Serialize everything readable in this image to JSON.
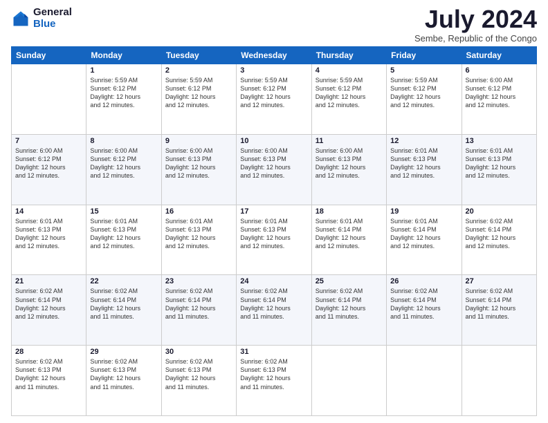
{
  "logo": {
    "general": "General",
    "blue": "Blue"
  },
  "header": {
    "month": "July 2024",
    "location": "Sembe, Republic of the Congo"
  },
  "weekdays": [
    "Sunday",
    "Monday",
    "Tuesday",
    "Wednesday",
    "Thursday",
    "Friday",
    "Saturday"
  ],
  "weeks": [
    [
      {
        "day": "",
        "info": ""
      },
      {
        "day": "1",
        "info": "Sunrise: 5:59 AM\nSunset: 6:12 PM\nDaylight: 12 hours\nand 12 minutes."
      },
      {
        "day": "2",
        "info": "Sunrise: 5:59 AM\nSunset: 6:12 PM\nDaylight: 12 hours\nand 12 minutes."
      },
      {
        "day": "3",
        "info": "Sunrise: 5:59 AM\nSunset: 6:12 PM\nDaylight: 12 hours\nand 12 minutes."
      },
      {
        "day": "4",
        "info": "Sunrise: 5:59 AM\nSunset: 6:12 PM\nDaylight: 12 hours\nand 12 minutes."
      },
      {
        "day": "5",
        "info": "Sunrise: 5:59 AM\nSunset: 6:12 PM\nDaylight: 12 hours\nand 12 minutes."
      },
      {
        "day": "6",
        "info": "Sunrise: 6:00 AM\nSunset: 6:12 PM\nDaylight: 12 hours\nand 12 minutes."
      }
    ],
    [
      {
        "day": "7",
        "info": ""
      },
      {
        "day": "8",
        "info": "Sunrise: 6:00 AM\nSunset: 6:12 PM\nDaylight: 12 hours\nand 12 minutes."
      },
      {
        "day": "9",
        "info": "Sunrise: 6:00 AM\nSunset: 6:13 PM\nDaylight: 12 hours\nand 12 minutes."
      },
      {
        "day": "10",
        "info": "Sunrise: 6:00 AM\nSunset: 6:13 PM\nDaylight: 12 hours\nand 12 minutes."
      },
      {
        "day": "11",
        "info": "Sunrise: 6:00 AM\nSunset: 6:13 PM\nDaylight: 12 hours\nand 12 minutes."
      },
      {
        "day": "12",
        "info": "Sunrise: 6:01 AM\nSunset: 6:13 PM\nDaylight: 12 hours\nand 12 minutes."
      },
      {
        "day": "13",
        "info": "Sunrise: 6:01 AM\nSunset: 6:13 PM\nDaylight: 12 hours\nand 12 minutes."
      }
    ],
    [
      {
        "day": "14",
        "info": ""
      },
      {
        "day": "15",
        "info": "Sunrise: 6:01 AM\nSunset: 6:13 PM\nDaylight: 12 hours\nand 12 minutes."
      },
      {
        "day": "16",
        "info": "Sunrise: 6:01 AM\nSunset: 6:13 PM\nDaylight: 12 hours\nand 12 minutes."
      },
      {
        "day": "17",
        "info": "Sunrise: 6:01 AM\nSunset: 6:13 PM\nDaylight: 12 hours\nand 12 minutes."
      },
      {
        "day": "18",
        "info": "Sunrise: 6:01 AM\nSunset: 6:14 PM\nDaylight: 12 hours\nand 12 minutes."
      },
      {
        "day": "19",
        "info": "Sunrise: 6:01 AM\nSunset: 6:14 PM\nDaylight: 12 hours\nand 12 minutes."
      },
      {
        "day": "20",
        "info": "Sunrise: 6:02 AM\nSunset: 6:14 PM\nDaylight: 12 hours\nand 12 minutes."
      }
    ],
    [
      {
        "day": "21",
        "info": ""
      },
      {
        "day": "22",
        "info": "Sunrise: 6:02 AM\nSunset: 6:14 PM\nDaylight: 12 hours\nand 11 minutes."
      },
      {
        "day": "23",
        "info": "Sunrise: 6:02 AM\nSunset: 6:14 PM\nDaylight: 12 hours\nand 11 minutes."
      },
      {
        "day": "24",
        "info": "Sunrise: 6:02 AM\nSunset: 6:14 PM\nDaylight: 12 hours\nand 11 minutes."
      },
      {
        "day": "25",
        "info": "Sunrise: 6:02 AM\nSunset: 6:14 PM\nDaylight: 12 hours\nand 11 minutes."
      },
      {
        "day": "26",
        "info": "Sunrise: 6:02 AM\nSunset: 6:14 PM\nDaylight: 12 hours\nand 11 minutes."
      },
      {
        "day": "27",
        "info": "Sunrise: 6:02 AM\nSunset: 6:14 PM\nDaylight: 12 hours\nand 11 minutes."
      }
    ],
    [
      {
        "day": "28",
        "info": "Sunrise: 6:02 AM\nSunset: 6:13 PM\nDaylight: 12 hours\nand 11 minutes."
      },
      {
        "day": "29",
        "info": "Sunrise: 6:02 AM\nSunset: 6:13 PM\nDaylight: 12 hours\nand 11 minutes."
      },
      {
        "day": "30",
        "info": "Sunrise: 6:02 AM\nSunset: 6:13 PM\nDaylight: 12 hours\nand 11 minutes."
      },
      {
        "day": "31",
        "info": "Sunrise: 6:02 AM\nSunset: 6:13 PM\nDaylight: 12 hours\nand 11 minutes."
      },
      {
        "day": "",
        "info": ""
      },
      {
        "day": "",
        "info": ""
      },
      {
        "day": "",
        "info": ""
      }
    ]
  ],
  "week1_sunday_info": "Sunrise: 6:00 AM\nSunset: 6:12 PM\nDaylight: 12 hours\nand 12 minutes.",
  "week2_sunday_info": "Sunrise: 6:00 AM\nSunset: 6:12 PM\nDaylight: 12 hours\nand 12 minutes.",
  "week3_sunday_info": "Sunrise: 6:01 AM\nSunset: 6:13 PM\nDaylight: 12 hours\nand 12 minutes.",
  "week4_sunday_info": "Sunrise: 6:02 AM\nSunset: 6:14 PM\nDaylight: 12 hours\nand 12 minutes."
}
